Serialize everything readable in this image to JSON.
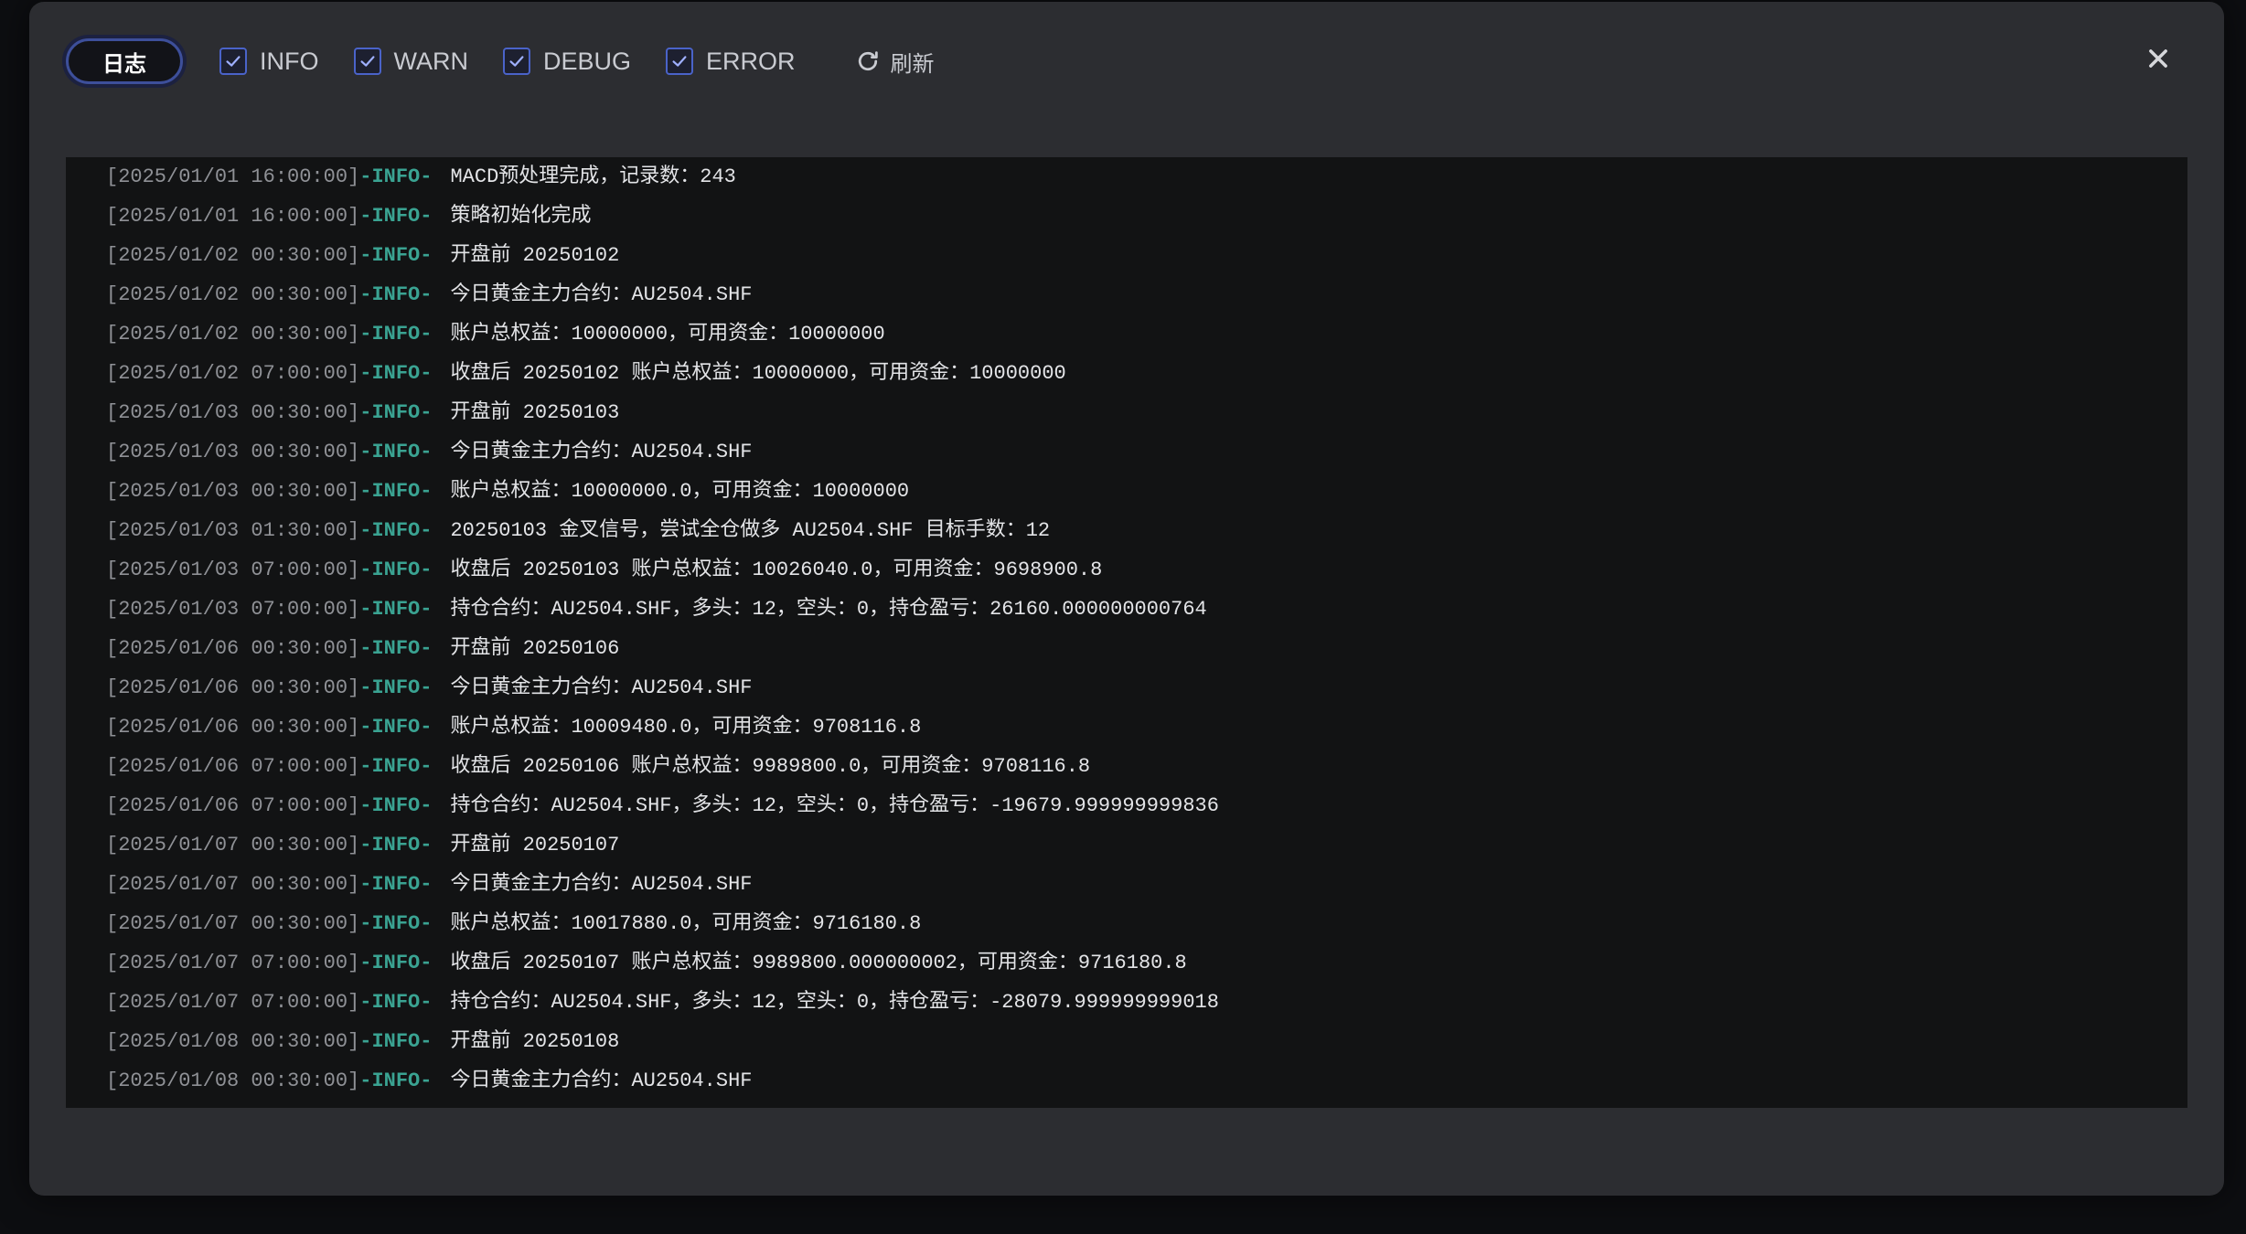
{
  "toolbar": {
    "log_button": "日志",
    "filters": [
      {
        "label": "INFO",
        "checked": true
      },
      {
        "label": "WARN",
        "checked": true
      },
      {
        "label": "DEBUG",
        "checked": true
      },
      {
        "label": "ERROR",
        "checked": true
      }
    ],
    "refresh_label": "刷新"
  },
  "icons": {
    "close": "close-icon",
    "refresh": "refresh-icon",
    "check": "checkmark-icon"
  },
  "colors": {
    "accent": "#4a63c9",
    "info_level": "#3aa392",
    "timestamp": "#8f9196",
    "message": "#e3e4e7",
    "panel_bg": "#121314",
    "modal_bg": "#2c2d31"
  },
  "logs": [
    {
      "ts": "[2025/01/01 16:00:00]",
      "level": "-INFO-",
      "msg": "MACD预处理完成，记录数：243"
    },
    {
      "ts": "[2025/01/01 16:00:00]",
      "level": "-INFO-",
      "msg": "策略初始化完成"
    },
    {
      "ts": "[2025/01/02 00:30:00]",
      "level": "-INFO-",
      "msg": "开盘前 20250102"
    },
    {
      "ts": "[2025/01/02 00:30:00]",
      "level": "-INFO-",
      "msg": "今日黄金主力合约：AU2504.SHF"
    },
    {
      "ts": "[2025/01/02 00:30:00]",
      "level": "-INFO-",
      "msg": "账户总权益：10000000，可用资金：10000000"
    },
    {
      "ts": "[2025/01/02 07:00:00]",
      "level": "-INFO-",
      "msg": "收盘后 20250102 账户总权益：10000000，可用资金：10000000"
    },
    {
      "ts": "[2025/01/03 00:30:00]",
      "level": "-INFO-",
      "msg": "开盘前 20250103"
    },
    {
      "ts": "[2025/01/03 00:30:00]",
      "level": "-INFO-",
      "msg": "今日黄金主力合约：AU2504.SHF"
    },
    {
      "ts": "[2025/01/03 00:30:00]",
      "level": "-INFO-",
      "msg": "账户总权益：10000000.0，可用资金：10000000"
    },
    {
      "ts": "[2025/01/03 01:30:00]",
      "level": "-INFO-",
      "msg": "20250103 金叉信号，尝试全仓做多 AU2504.SHF 目标手数：12"
    },
    {
      "ts": "[2025/01/03 07:00:00]",
      "level": "-INFO-",
      "msg": "收盘后 20250103 账户总权益：10026040.0，可用资金：9698900.8"
    },
    {
      "ts": "[2025/01/03 07:00:00]",
      "level": "-INFO-",
      "msg": "持仓合约：AU2504.SHF，多头：12，空头：0，持仓盈亏：26160.000000000764"
    },
    {
      "ts": "[2025/01/06 00:30:00]",
      "level": "-INFO-",
      "msg": "开盘前 20250106"
    },
    {
      "ts": "[2025/01/06 00:30:00]",
      "level": "-INFO-",
      "msg": "今日黄金主力合约：AU2504.SHF"
    },
    {
      "ts": "[2025/01/06 00:30:00]",
      "level": "-INFO-",
      "msg": "账户总权益：10009480.0，可用资金：9708116.8"
    },
    {
      "ts": "[2025/01/06 07:00:00]",
      "level": "-INFO-",
      "msg": "收盘后 20250106 账户总权益：9989800.0，可用资金：9708116.8"
    },
    {
      "ts": "[2025/01/06 07:00:00]",
      "level": "-INFO-",
      "msg": "持仓合约：AU2504.SHF，多头：12，空头：0，持仓盈亏：-19679.999999999836"
    },
    {
      "ts": "[2025/01/07 00:30:00]",
      "level": "-INFO-",
      "msg": "开盘前 20250107"
    },
    {
      "ts": "[2025/01/07 00:30:00]",
      "level": "-INFO-",
      "msg": "今日黄金主力合约：AU2504.SHF"
    },
    {
      "ts": "[2025/01/07 00:30:00]",
      "level": "-INFO-",
      "msg": "账户总权益：10017880.0，可用资金：9716180.8"
    },
    {
      "ts": "[2025/01/07 07:00:00]",
      "level": "-INFO-",
      "msg": "收盘后 20250107 账户总权益：9989800.000000002，可用资金：9716180.8"
    },
    {
      "ts": "[2025/01/07 07:00:00]",
      "level": "-INFO-",
      "msg": "持仓合约：AU2504.SHF，多头：12，空头：0，持仓盈亏：-28079.999999999018"
    },
    {
      "ts": "[2025/01/08 00:30:00]",
      "level": "-INFO-",
      "msg": "开盘前 20250108"
    },
    {
      "ts": "[2025/01/08 00:30:00]",
      "level": "-INFO-",
      "msg": "今日黄金主力合约：AU2504.SHF"
    }
  ]
}
